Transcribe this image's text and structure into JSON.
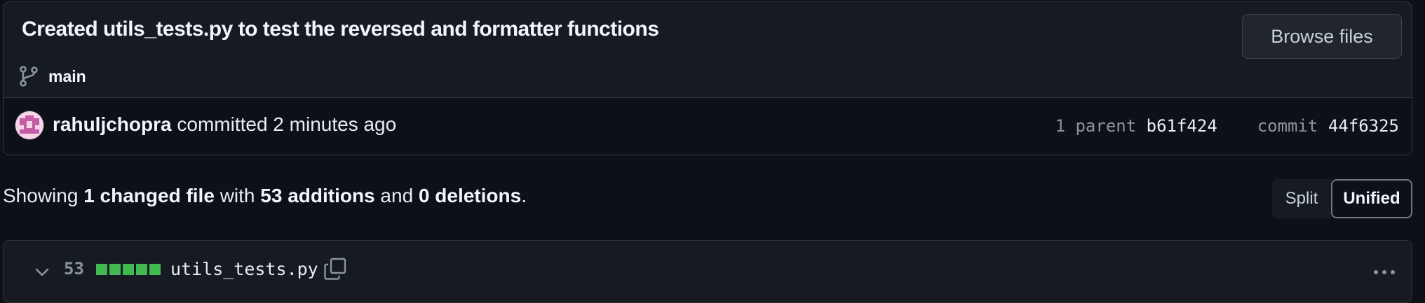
{
  "commit": {
    "title": "Created utils_tests.py to test the reversed and formatter functions",
    "branch": "main",
    "browse_label": "Browse files",
    "author": "rahuljchopra",
    "action": "committed 2 minutes ago",
    "parent_label": "1 parent",
    "parent_sha": "b61f424",
    "commit_label": "commit",
    "commit_sha": "44f6325"
  },
  "summary": {
    "prefix": "Showing",
    "changed": "1 changed file",
    "with": "with",
    "additions": "53 additions",
    "and": "and",
    "deletions": "0 deletions",
    "suffix": "."
  },
  "view_toggle": {
    "split_label": "Split",
    "unified_label": "Unified",
    "selected": "Unified"
  },
  "files": [
    {
      "change_count": "53",
      "diffstat_blocks": 5,
      "name": "utils_tests.py"
    }
  ],
  "colors": {
    "background": "#0d1117",
    "panel": "#161b22",
    "border": "#30363d",
    "addition_green": "#3fb950",
    "muted_text": "#8b949e"
  },
  "icons": {
    "branch": "git-branch-icon",
    "avatar": "identicon-avatar",
    "chevron": "chevron-down-icon",
    "copy": "copy-icon",
    "menu": "kebab-menu-icon"
  }
}
